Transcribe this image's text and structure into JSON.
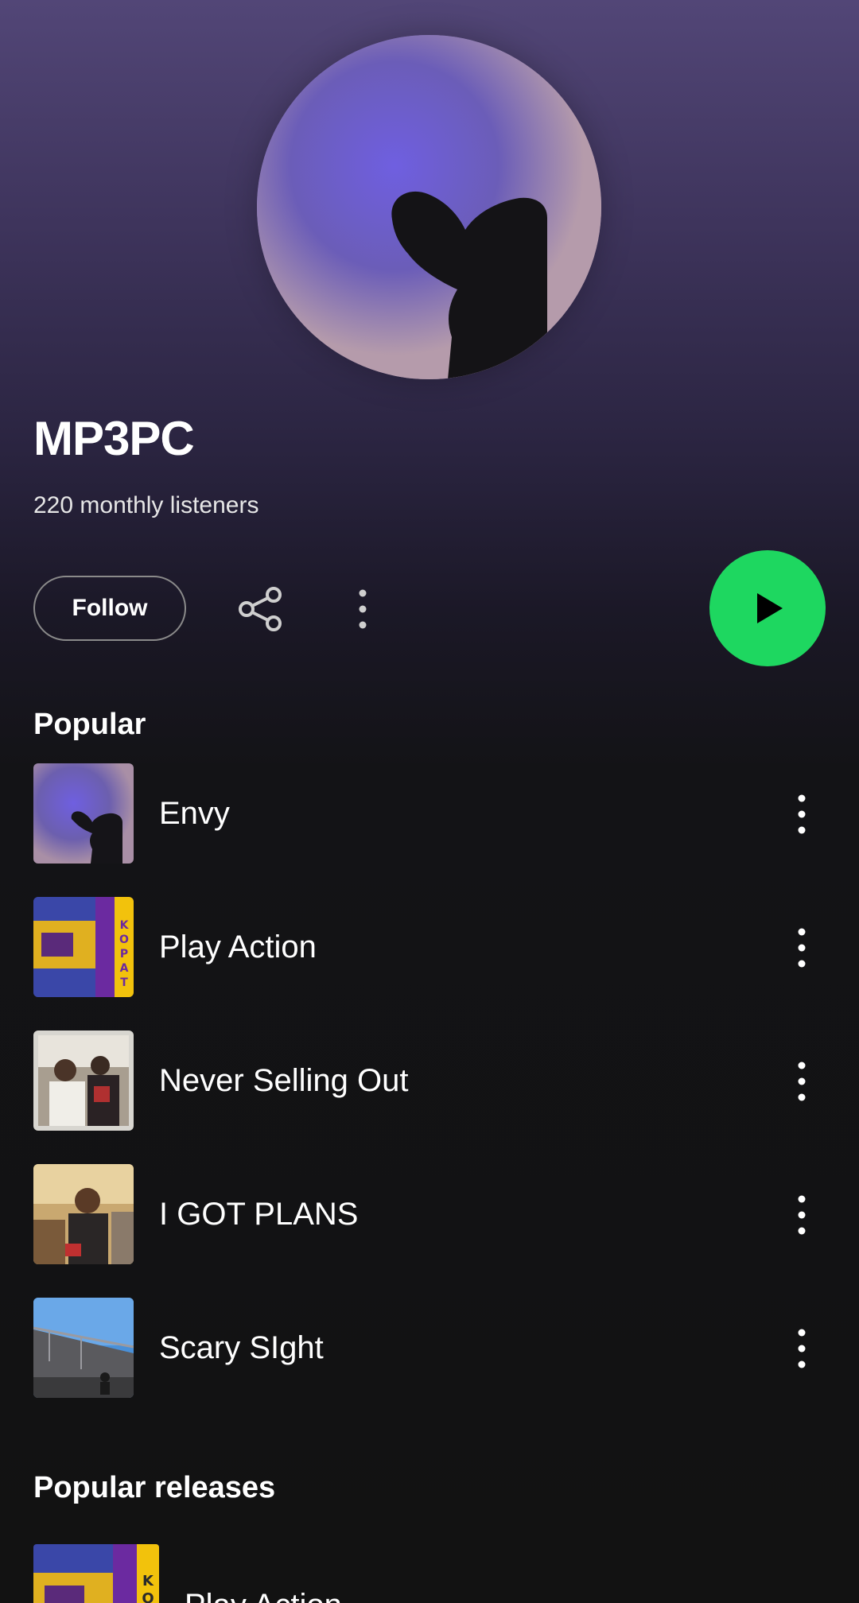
{
  "artist": {
    "name": "MP3PC",
    "monthly_listeners": "220 monthly listeners"
  },
  "actions": {
    "follow_label": "Follow",
    "share_icon": "share-icon",
    "more_icon": "more-vertical-icon",
    "play_icon": "play-icon"
  },
  "popular": {
    "title": "Popular",
    "tracks": [
      {
        "title": "Envy"
      },
      {
        "title": "Play Action"
      },
      {
        "title": "Never Selling Out"
      },
      {
        "title": "I GOT PLANS"
      },
      {
        "title": "Scary SIght"
      }
    ]
  },
  "popular_releases": {
    "title": "Popular releases",
    "items": [
      {
        "title": "Play Action",
        "cover_text": "KOPAT"
      }
    ]
  },
  "colors": {
    "accent_green": "#1ed760",
    "background": "#121212",
    "hero_purple": "#524677"
  }
}
